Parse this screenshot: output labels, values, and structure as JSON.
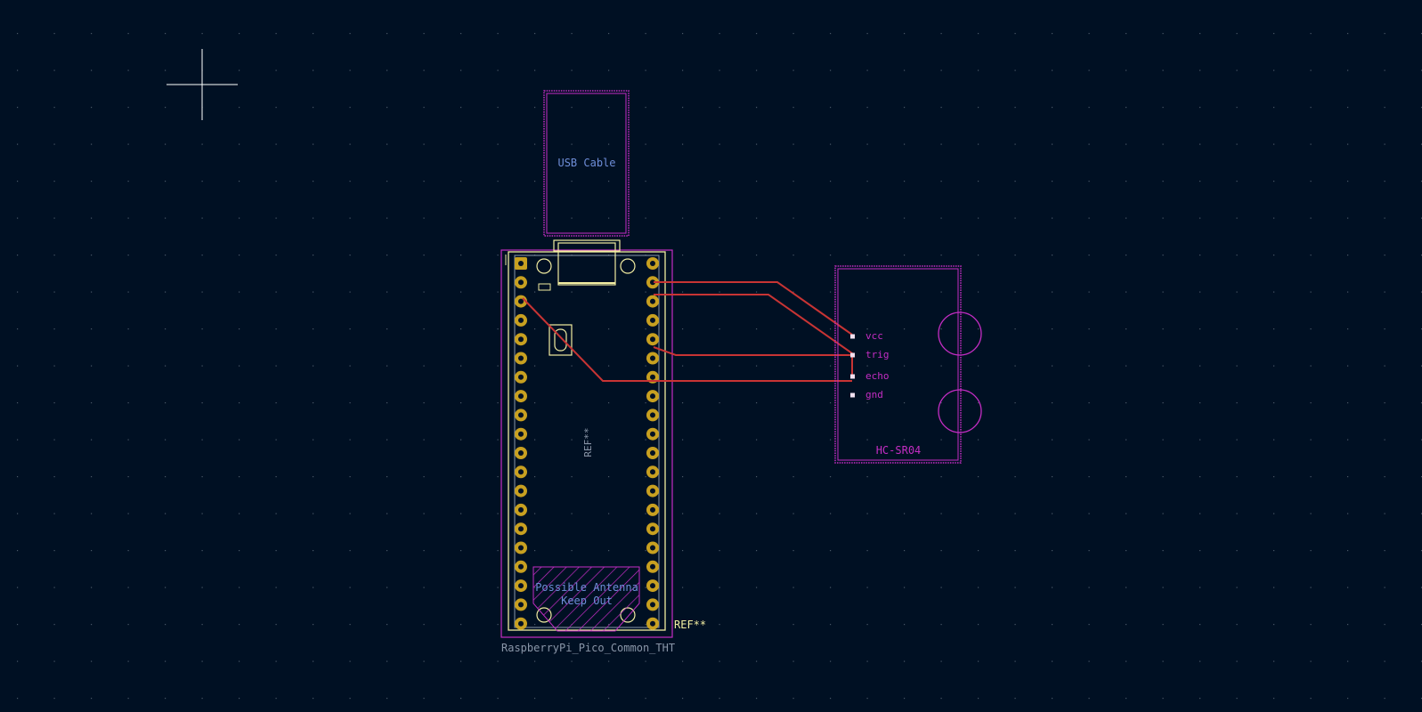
{
  "colors": {
    "background": "#001023",
    "grid": "#4a5868",
    "courtyard": "#c42dc4",
    "silkscreen": "#f2eda1",
    "fab": "#8a96a8",
    "pad": "#c8a020",
    "track": "#c83434",
    "user_text": "#6e8ed8",
    "cursor": "#ffffff"
  },
  "usb": {
    "label": "USB Cable"
  },
  "pico": {
    "ref": "REF**",
    "ref_silk": "REF**",
    "value": "RaspberryPi_Pico_Common_THT",
    "antenna_line1": "Possible Antenna",
    "antenna_line2": "Keep Out",
    "pin_count_per_side": 20
  },
  "sensor": {
    "name": "HC-SR04",
    "pins": [
      "vcc",
      "trig",
      "echo",
      "gnd"
    ]
  },
  "icons": [
    "crosshair-cursor-icon"
  ]
}
